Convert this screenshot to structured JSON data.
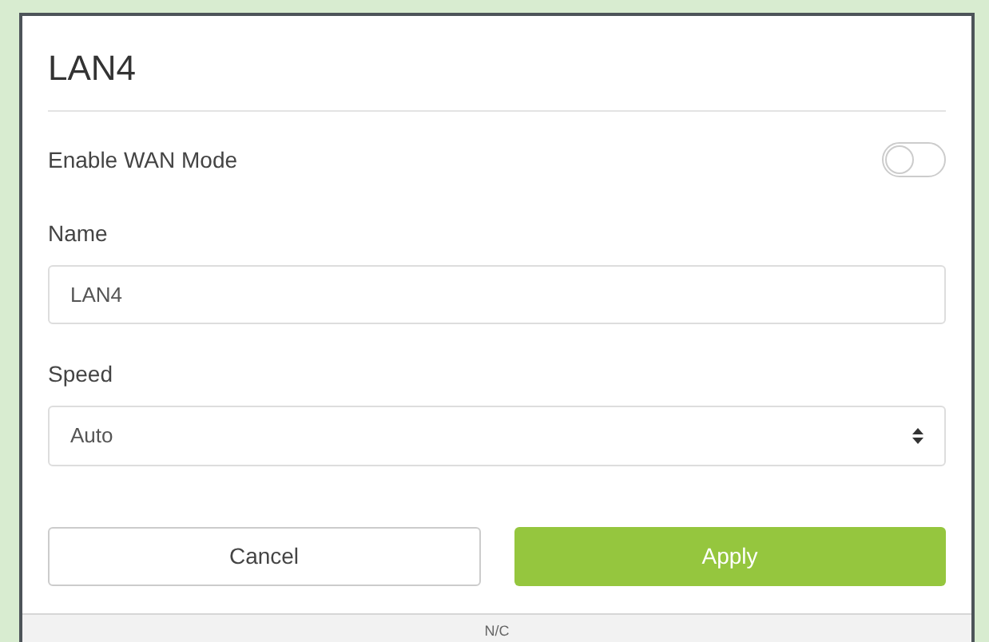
{
  "dialog": {
    "title": "LAN4"
  },
  "wan_mode": {
    "label": "Enable WAN Mode",
    "on": false
  },
  "name": {
    "label": "Name",
    "value": "LAN4"
  },
  "speed": {
    "label": "Speed",
    "value": "Auto"
  },
  "buttons": [
    {
      "label": "Cancel",
      "kind": "secondary"
    },
    {
      "label": "Apply",
      "kind": "primary"
    }
  ],
  "footer": {
    "text": "N/C"
  }
}
